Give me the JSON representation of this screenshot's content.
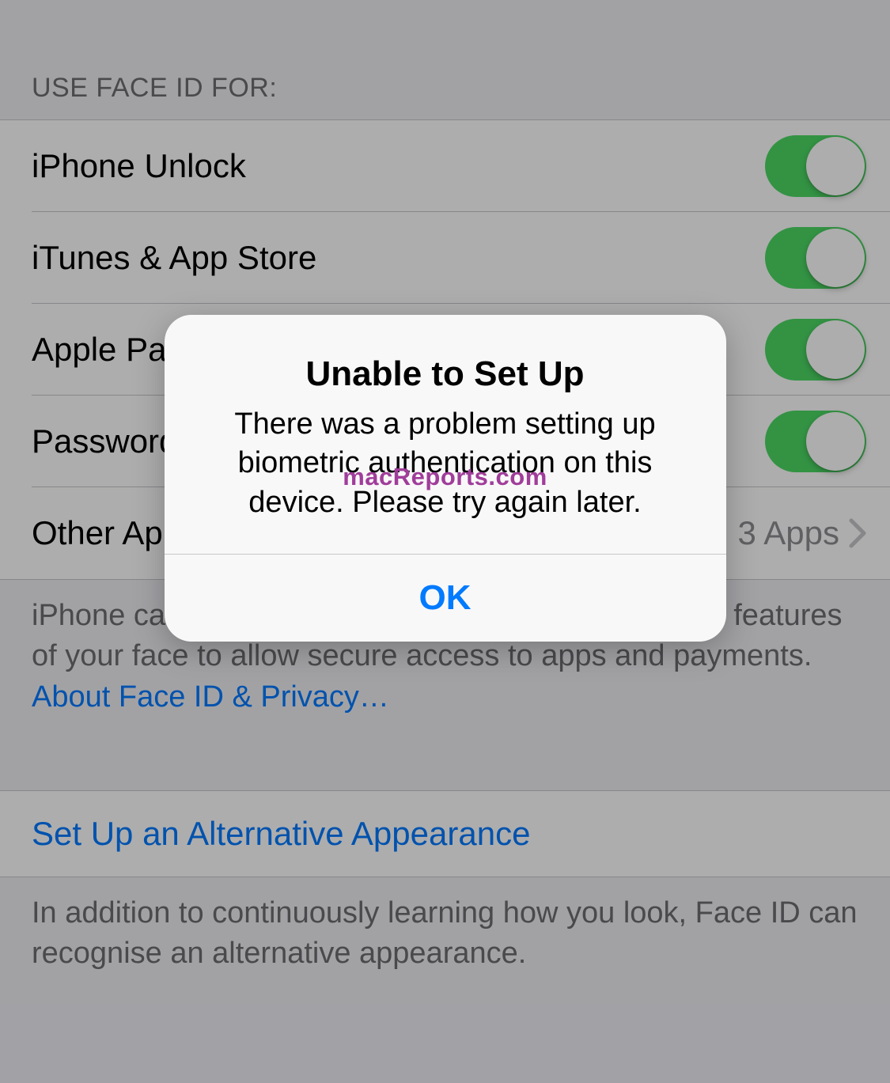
{
  "section": {
    "header": "USE FACE ID FOR:",
    "rows": [
      {
        "label": "iPhone Unlock"
      },
      {
        "label": "iTunes & App Store"
      },
      {
        "label": "Apple Pay"
      },
      {
        "label": "Password AutoFill"
      }
    ],
    "otherApps": {
      "label": "Other Apps",
      "value": "3 Apps"
    }
  },
  "footer": {
    "text": "iPhone can recognise the unique, three-dimensional features of your face to allow secure access to apps and payments. ",
    "link": "About Face ID & Privacy…"
  },
  "altAppearance": {
    "action": "Set Up an Alternative Appearance",
    "footer": "In addition to continuously learning how you look, Face ID can recognise an alternative appearance."
  },
  "alert": {
    "title": "Unable to Set Up",
    "message": "There was a problem setting up biometric authentication on this device. Please try again later.",
    "button": "OK"
  },
  "watermark": "macReports.com"
}
